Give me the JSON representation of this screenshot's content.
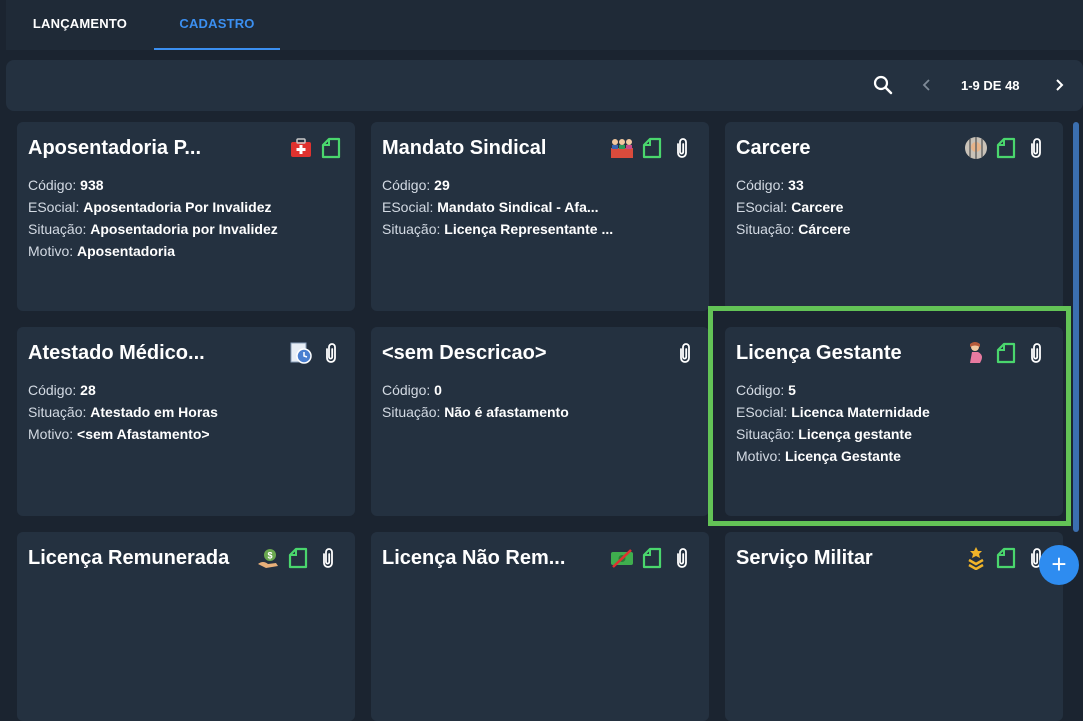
{
  "tabs": [
    {
      "label": "LANÇAMENTO",
      "active": false
    },
    {
      "label": "CADASTRO",
      "active": true
    }
  ],
  "toolbar": {
    "search_icon": "search-icon",
    "prev_icon": "chevron-left-icon",
    "range": "1-9 DE 48",
    "next_icon": "chevron-right-icon"
  },
  "labels": {
    "codigo": "Código:",
    "esocial": "ESocial:",
    "situacao": "Situação:",
    "motivo": "Motivo:"
  },
  "cards": [
    {
      "title": "Aposentadoria P...",
      "codigo": "938",
      "esocial": "Aposentadoria Por Invalidez",
      "situacao": "Aposentadoria por Invalidez",
      "motivo": "Aposentadoria",
      "icons": [
        "first-aid-kit-icon",
        "document-icon"
      ]
    },
    {
      "title": "Mandato Sindical",
      "codigo": "29",
      "esocial": "Mandato Sindical - Afa...",
      "situacao": "Licença Representante ...",
      "icons": [
        "group-icon",
        "document-icon",
        "paperclip-icon"
      ]
    },
    {
      "title": "Carcere",
      "codigo": "33",
      "esocial": "Carcere",
      "situacao": "Cárcere",
      "icons": [
        "prisoner-icon",
        "document-icon",
        "paperclip-icon"
      ]
    },
    {
      "title": "Atestado Médico...",
      "codigo": "28",
      "situacao": "Atestado em Horas",
      "motivo": "<sem Afastamento>",
      "icons": [
        "clock-icon",
        "paperclip-icon"
      ]
    },
    {
      "title": "<sem Descricao>",
      "codigo": "0",
      "situacao": "Não é afastamento",
      "icons": [
        "paperclip-icon"
      ]
    },
    {
      "title": "Licença Gestante",
      "codigo": "5",
      "esocial": "Licenca Maternidade",
      "situacao": "Licença gestante",
      "motivo": "Licença Gestante",
      "icons": [
        "pregnant-woman-icon",
        "document-icon",
        "paperclip-icon"
      ]
    },
    {
      "title": "Licença Remunerada",
      "icons": [
        "money-bag-icon",
        "document-icon",
        "paperclip-icon"
      ]
    },
    {
      "title": "Licença Não Rem...",
      "icons": [
        "no-money-icon",
        "document-icon",
        "paperclip-icon"
      ]
    },
    {
      "title": "Serviço Militar",
      "icons": [
        "military-rank-icon",
        "document-icon",
        "paperclip-icon"
      ]
    }
  ],
  "colors": {
    "background": "#1b2430",
    "card": "#243140",
    "accent": "#3b8ff0",
    "highlight": "#63c356",
    "document_icon": "#4ad66d"
  },
  "fab_icon": "plus-icon"
}
